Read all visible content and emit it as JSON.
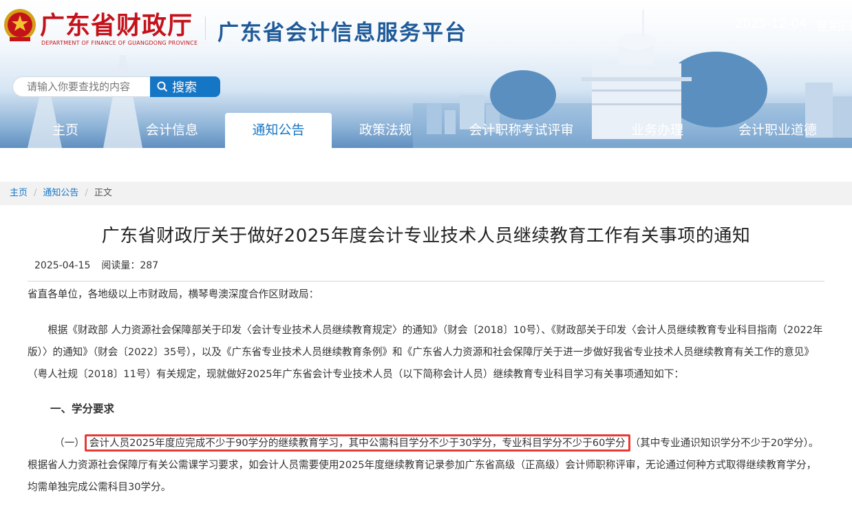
{
  "header": {
    "site_name": "广东省财政厅",
    "site_name_en": "DEPARTMENT OF FINANCE OF GUANGDONG PROVINCE",
    "platform_title": "广东省会计信息服务平台",
    "date": "2025-12-04",
    "weekday": "星期四",
    "colors": {
      "brand_red": "#c4121a",
      "brand_blue": "#1f5a98",
      "accent": "#1676c6"
    }
  },
  "search": {
    "placeholder": "请输入你要查找的内容",
    "value": "",
    "button_label": "搜索",
    "icon": "search-icon"
  },
  "nav": {
    "items": [
      {
        "label": "主页",
        "active": false
      },
      {
        "label": "会计信息",
        "active": false
      },
      {
        "label": "通知公告",
        "active": true
      },
      {
        "label": "政策法规",
        "active": false
      },
      {
        "label": "会计职称考试评审",
        "active": false
      },
      {
        "label": "业务办理",
        "active": false
      },
      {
        "label": "会计职业道德",
        "active": false
      }
    ]
  },
  "breadcrumb": {
    "items": [
      "主页",
      "通知公告",
      "正文"
    ],
    "separator": "/"
  },
  "article": {
    "title": "广东省财政厅关于做好2025年度会计专业技术人员继续教育工作有关事项的通知",
    "date": "2025-04-15",
    "views_label": "阅读量：287",
    "salutation": "省直各单位，各地级以上市财政局，横琴粤澳深度合作区财政局：",
    "intro": "根据《财政部 人力资源社会保障部关于印发〈会计专业技术人员继续教育规定〉的通知》（财会〔2018〕10号）、《财政部关于印发〈会计人员继续教育专业科目指南（2022年版）〉的通知》（财会〔2022〕35号），以及《广东省专业技术人员继续教育条例》和《广东省人力资源和社会保障厅关于进一步做好我省专业技术人员继续教育有关工作的意见》（粤人社规〔2018〕11号）有关规定，现就做好2025年广东省会计专业技术人员（以下简称会计人员）继续教育专业科目学习有关事项通知如下：",
    "section_heading": "一、学分要求",
    "item_label": "（一）",
    "item_highlight": "会计人员2025年度应完成不少于90学分的继续教育学习，其中公需科目学分不少于30学分，专业科目学分不少于60学分",
    "item_rest": "（其中专业通识知识学分不少于20学分）。根据省人力资源社会保障厅有关公需课学习要求，如会计人员需要使用2025年度继续教育记录参加广东省高级（正高级）会计师职称评审，无论通过何种方式取得继续教育学分，均需单独完成公需科目30学分。",
    "highlight_color": "#e53935"
  }
}
